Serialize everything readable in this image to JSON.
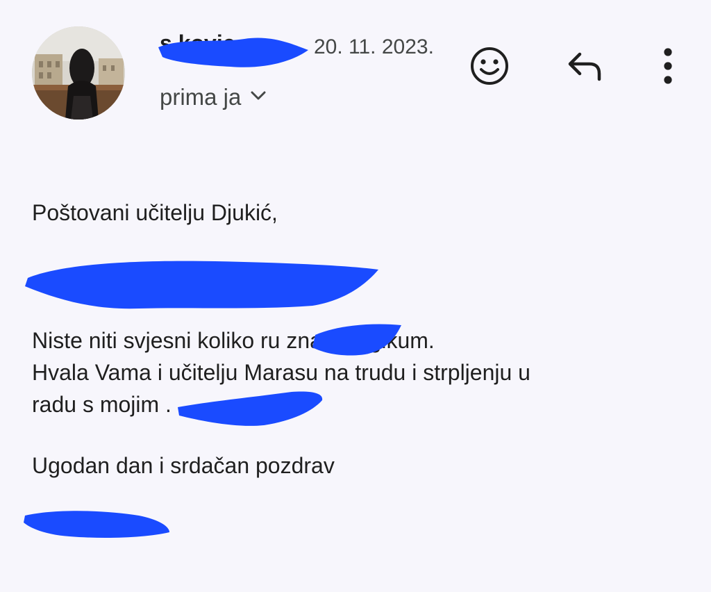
{
  "header": {
    "sender_name": "s      kovic",
    "date": "20. 11. 2023.",
    "recipient_label": "prima ja",
    "icons": {
      "avatar": "sender-avatar-photo",
      "chevron": "chevron-down-icon",
      "emoji": "add-reaction-icon",
      "reply": "reply-icon",
      "more": "more-vert-icon"
    }
  },
  "message": {
    "greeting": "Poštovani učitelju Djukić,",
    "paragraph_line1": "Niste niti svjesni  koliko       ru znači Logikum.",
    "paragraph_line2": "Hvala Vama i učitelju Marasu na trudu i strpljenju u",
    "paragraph_line3": "radu s mojim                 .",
    "closing": "Ugodan dan i srdačan pozdrav"
  },
  "colors": {
    "background": "#f7f6fc",
    "text": "#1f1f1f",
    "secondary_text": "#444746",
    "redaction": "#1a4bff"
  }
}
